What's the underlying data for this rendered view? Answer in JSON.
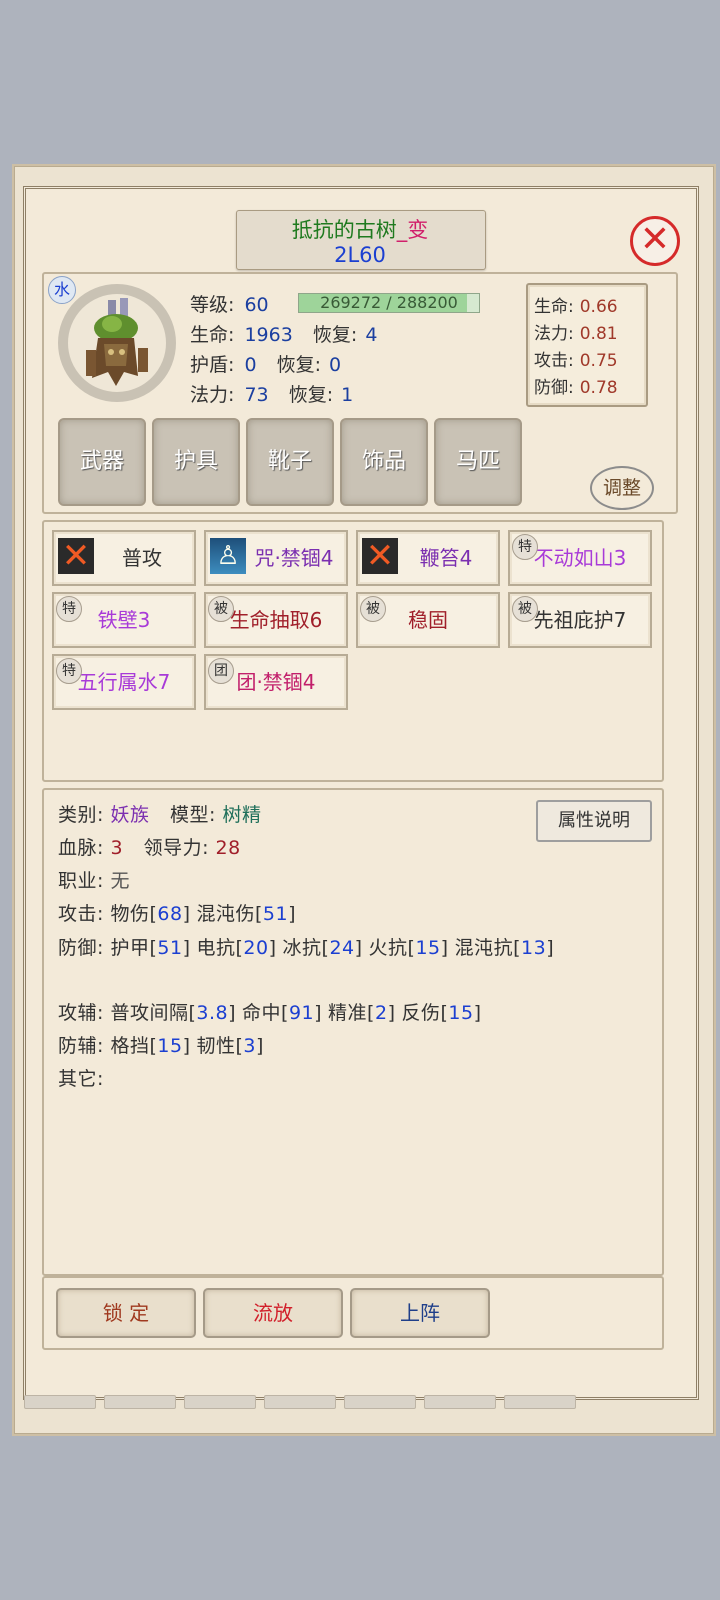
{
  "title": {
    "name": "抵抗的古树",
    "suffix": "_变",
    "subtitle": "2L60"
  },
  "portrait": {
    "element": "水"
  },
  "stats": {
    "level_label": "等级:",
    "level": "60",
    "exp": {
      "current": 269272,
      "max": 288200,
      "text": "269272 / 288200"
    },
    "hp_label": "生命:",
    "hp": "1963",
    "hp_regen_label": "恢复:",
    "hp_regen": "4",
    "shield_label": "护盾:",
    "shield": "0",
    "shield_regen_label": "恢复:",
    "shield_regen": "0",
    "mp_label": "法力:",
    "mp": "73",
    "mp_regen_label": "恢复:",
    "mp_regen": "1"
  },
  "growth": [
    {
      "label": "生命:",
      "value": "0.66"
    },
    {
      "label": "法力:",
      "value": "0.81"
    },
    {
      "label": "攻击:",
      "value": "0.75"
    },
    {
      "label": "防御:",
      "value": "0.78"
    }
  ],
  "equipment": [
    "武器",
    "护具",
    "靴子",
    "饰品",
    "马匹"
  ],
  "adjust_label": "调整",
  "skills": [
    {
      "label": "普攻",
      "icon": "x-icon",
      "badge": "",
      "color": "#333333"
    },
    {
      "label": "咒·禁锢4",
      "icon": "figure-icon",
      "badge": "",
      "color": "#7b2fb0"
    },
    {
      "label": "鞭笞4",
      "icon": "x-icon",
      "badge": "",
      "color": "#7b2fb0"
    },
    {
      "label": "不动如山3",
      "icon": "",
      "badge": "特",
      "color": "#a83ad8"
    },
    {
      "label": "铁壁3",
      "icon": "",
      "badge": "特",
      "color": "#a83ad8"
    },
    {
      "label": "生命抽取6",
      "icon": "",
      "badge": "被",
      "color": "#a01f2a"
    },
    {
      "label": "稳固",
      "icon": "",
      "badge": "被",
      "color": "#a01f2a"
    },
    {
      "label": "先祖庇护7",
      "icon": "",
      "badge": "被",
      "color": "#333333"
    },
    {
      "label": "五行属水7",
      "icon": "",
      "badge": "特",
      "color": "#a83ad8"
    },
    {
      "label": "团·禁锢4",
      "icon": "",
      "badge": "团",
      "color": "#c21f6b"
    }
  ],
  "attributes": {
    "category_label": "类别:",
    "category": "妖族",
    "model_label": "模型:",
    "model": "树精",
    "bloodline_label": "血脉:",
    "bloodline": "3",
    "leadership_label": "领导力:",
    "leadership": "28",
    "job_label": "职业:",
    "job": "无",
    "attack_label": "攻击:",
    "attack_items": [
      {
        "name": "物伤",
        "value": "68"
      },
      {
        "name": "混沌伤",
        "value": "51"
      }
    ],
    "defense_label": "防御:",
    "defense_items": [
      {
        "name": "护甲",
        "value": "51"
      },
      {
        "name": "电抗",
        "value": "20"
      },
      {
        "name": "冰抗",
        "value": "24"
      },
      {
        "name": "火抗",
        "value": "15"
      },
      {
        "name": "混沌抗",
        "value": "13"
      }
    ],
    "atk_aux_label": "攻辅:",
    "atk_aux_items": [
      {
        "name": "普攻间隔",
        "value": "3.8"
      },
      {
        "name": "命中",
        "value": "91"
      },
      {
        "name": "精准",
        "value": "2"
      },
      {
        "name": "反伤",
        "value": "15"
      }
    ],
    "def_aux_label": "防辅:",
    "def_aux_items": [
      {
        "name": "格挡",
        "value": "15"
      },
      {
        "name": "韧性",
        "value": "3"
      }
    ],
    "other_label": "其它:"
  },
  "attr_explain_label": "属性说明",
  "actions": [
    {
      "label": "锁 定",
      "color": "#a0391f"
    },
    {
      "label": "流放",
      "color": "#d11f2a"
    },
    {
      "label": "上阵",
      "color": "#1f3f8a"
    }
  ]
}
